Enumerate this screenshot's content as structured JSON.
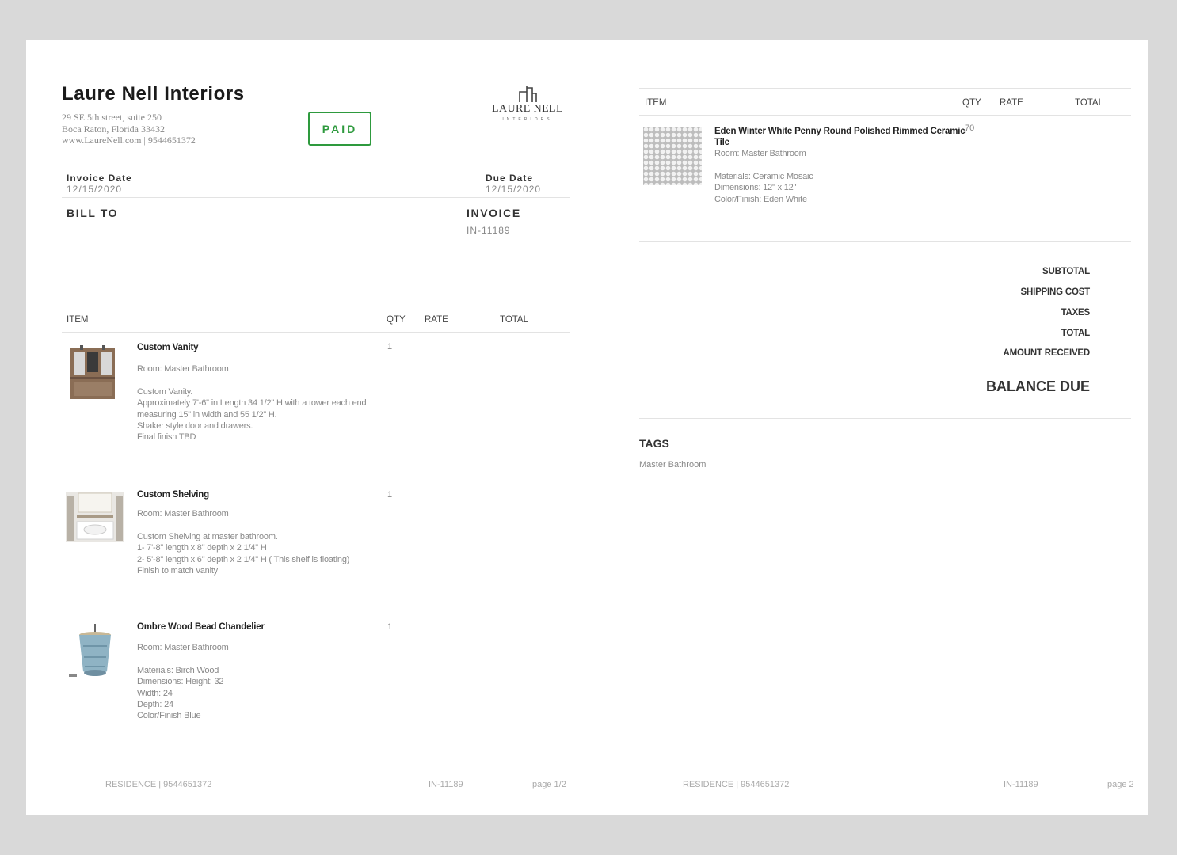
{
  "company": {
    "name": "Laure Nell Interiors",
    "address_line1": "29 SE 5th street, suite 250",
    "address_line2": "Boca Raton, Florida 33432",
    "contact": "www.LaureNell.com | 9544651372"
  },
  "status_badge": "PAID",
  "logo": {
    "name": "LAURE NELL",
    "sub": "INTERIORS"
  },
  "invoice": {
    "date_label": "Invoice Date",
    "date_value": "12/15/2020",
    "due_label": "Due Date",
    "due_value": "12/15/2020",
    "bill_to_label": "BILL TO",
    "invoice_label": "INVOICE",
    "invoice_number": "IN-11189"
  },
  "table_headers": {
    "item": "ITEM",
    "qty": "QTY",
    "rate": "RATE",
    "total": "TOTAL"
  },
  "items": [
    {
      "name": "Custom Vanity",
      "qty": "1",
      "room": "Room: Master Bathroom",
      "details": "Custom Vanity.\nApproximately 7'-6\" in Length 34 1/2\" H with a tower each end\nmeasuring 15\" in width and 55 1/2\" H.\nShaker style door and drawers.\nFinal finish TBD"
    },
    {
      "name": "Custom Shelving",
      "qty": "1",
      "room": "Room: Master Bathroom",
      "details": "Custom Shelving at master bathroom.\n1- 7'-8\" length x 8\" depth x 2 1/4\" H\n2- 5'-8\" length x 6\" depth x 2 1/4\" H ( This shelf is floating)\nFinish to match vanity"
    },
    {
      "name": "Ombre Wood Bead Chandelier",
      "qty": "1",
      "room": "Room: Master Bathroom",
      "details": "Materials: Birch Wood\nDimensions: Height: 32\nWidth: 24\nDepth: 24\nColor/Finish Blue"
    },
    {
      "name": "Eden Winter White Penny Round Polished Rimmed Ceramic Tile",
      "qty": "70",
      "room": "Room: Master Bathroom",
      "details": "Materials: Ceramic Mosaic\nDimensions: 12\" x 12\"\nColor/Finish: Eden White"
    }
  ],
  "summary": {
    "subtotal": "SUBTOTAL",
    "shipping": "SHIPPING COST",
    "taxes": "TAXES",
    "total": "TOTAL",
    "received": "AMOUNT RECEIVED",
    "balance_due": "BALANCE DUE"
  },
  "tags": {
    "label": "TAGS",
    "value": "Master Bathroom"
  },
  "footer": {
    "left": "RESIDENCE | 9544651372",
    "invoice": "IN-11189",
    "page1": "page 1/2",
    "page2": "page 2"
  },
  "colors": {
    "paid_green": "#2e9a3e",
    "background": "#d9d9d9"
  }
}
